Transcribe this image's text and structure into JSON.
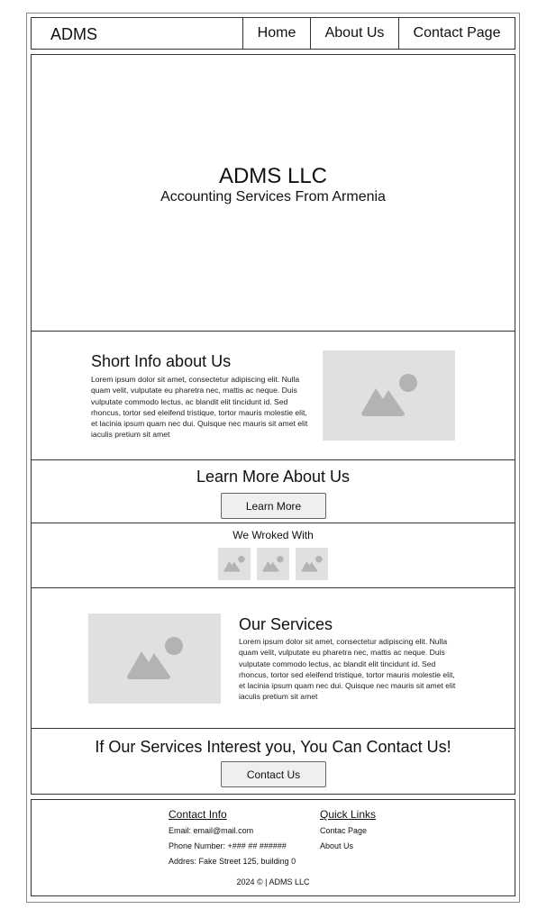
{
  "nav": {
    "brand": "ADMS",
    "items": [
      {
        "label": "Home"
      },
      {
        "label": "About Us"
      },
      {
        "label": "Contact Page"
      }
    ]
  },
  "hero": {
    "title": "ADMS LLC",
    "subtitle": "Accounting Services From Armenia"
  },
  "short_info": {
    "heading": "Short Info about Us",
    "body": "Lorem ipsum dolor sit amet, consectetur adipiscing elit. Nulla quam velit, vulputate eu pharetra nec, mattis ac neque. Duis vulputate commodo lectus, ac blandit elit tincidunt id. Sed rhoncus, tortor sed eleifend tristique, tortor mauris molestie elit, et lacinia ipsum quam nec dui. Quisque nec mauris sit amet elit iaculis pretium sit amet",
    "image_icon": "image-placeholder-icon"
  },
  "learn_more": {
    "heading": "Learn More About Us",
    "button": "Learn More"
  },
  "worked_with": {
    "heading": "We Wroked With",
    "logos": [
      "image-placeholder-icon",
      "image-placeholder-icon",
      "image-placeholder-icon"
    ]
  },
  "services": {
    "heading": "Our Services",
    "body": "Lorem ipsum dolor sit amet, consectetur adipiscing elit. Nulla quam velit, vulputate eu pharetra nec, mattis ac neque. Duis vulputate commodo lectus, ac blandit elit tincidunt id. Sed rhoncus, tortor sed eleifend tristique, tortor mauris molestie elit, et lacinia ipsum quam nec dui. Quisque nec mauris sit amet elit iaculis pretium sit amet",
    "image_icon": "image-placeholder-icon"
  },
  "contact_cta": {
    "heading": "If Our Services Interest you, You Can Contact Us!",
    "button": "Contact Us"
  },
  "footer": {
    "contact_heading": "Contact Info",
    "email": "Email: email@mail.com",
    "phone": "Phone Number: +### ## ######",
    "address": "Addres: Fake Street 125, building 0",
    "links_heading": "Quick Links",
    "link1": "Contac Page",
    "link2": "About Us",
    "copyright": "2024 © | ADMS LLC"
  },
  "colors": {
    "border": "#333333",
    "placeholder_bg": "#e0e0e0",
    "placeholder_icon": "#b3b3b3",
    "button_bg": "#efefef"
  }
}
